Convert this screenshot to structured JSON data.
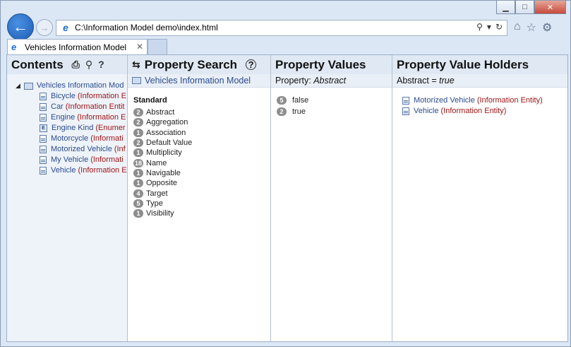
{
  "window": {
    "address": "C:\\Information Model demo\\index.html",
    "min_label": "▁",
    "max_label": "□",
    "close_label": "✕"
  },
  "tab": {
    "title": "Vehicles Information Model",
    "close": "✕"
  },
  "contents": {
    "title": "Contents",
    "root": {
      "name": "Vehicles Information Mod"
    },
    "items": [
      {
        "name": "Bicycle",
        "type": "(Information E",
        "icon": "document-icon"
      },
      {
        "name": "Car",
        "type": "(Information Entit",
        "icon": "document-icon"
      },
      {
        "name": "Engine",
        "type": "(Information E",
        "icon": "document-icon"
      },
      {
        "name": "Engine Kind",
        "type": "(Enumer",
        "icon": "enumeration-icon"
      },
      {
        "name": "Motorcycle",
        "type": "(Informati",
        "icon": "document-icon"
      },
      {
        "name": "Motorized Vehicle",
        "type": "(Inf",
        "icon": "document-icon"
      },
      {
        "name": "My Vehicle",
        "type": "(Informati",
        "icon": "document-icon"
      },
      {
        "name": "Vehicle",
        "type": "(Information E",
        "icon": "document-icon"
      }
    ]
  },
  "property_search": {
    "title": "Property Search",
    "model": "Vehicles Information Model",
    "section": "Standard",
    "properties": [
      {
        "count": "2",
        "name": "Abstract"
      },
      {
        "count": "2",
        "name": "Aggregation"
      },
      {
        "count": "1",
        "name": "Association"
      },
      {
        "count": "2",
        "name": "Default Value"
      },
      {
        "count": "1",
        "name": "Multiplicity"
      },
      {
        "count": "18",
        "name": "Name"
      },
      {
        "count": "1",
        "name": "Navigable"
      },
      {
        "count": "1",
        "name": "Opposite"
      },
      {
        "count": "4",
        "name": "Target"
      },
      {
        "count": "5",
        "name": "Type"
      },
      {
        "count": "1",
        "name": "Visibility"
      }
    ]
  },
  "property_values": {
    "title": "Property Values",
    "property_label": "Property:",
    "property_name": "Abstract",
    "values": [
      {
        "count": "5",
        "value": "false"
      },
      {
        "count": "2",
        "value": "true"
      }
    ]
  },
  "value_holders": {
    "title": "Property Value Holders",
    "filter_name": "Abstract =",
    "filter_value": "true",
    "items": [
      {
        "name": "Motorized Vehicle",
        "type": "(Information Entity)"
      },
      {
        "name": "Vehicle",
        "type": "(Information Entity)"
      }
    ]
  }
}
